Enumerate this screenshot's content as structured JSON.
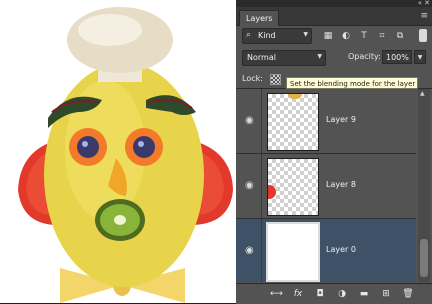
{
  "panel": {
    "window_controls": {
      "collapse": "«",
      "close": "✕"
    },
    "tab_label": "Layers",
    "menu_icon": "≡"
  },
  "filter": {
    "kind_icon": "⌕",
    "kind_label": "Kind",
    "dropdown": "▼",
    "icons": [
      "▦",
      "◐",
      "T",
      "⌗",
      "⧉"
    ]
  },
  "blend": {
    "mode": "Normal",
    "opacity_label": "Opacity:",
    "opacity_value": "100%"
  },
  "lock": {
    "label": "Lock:",
    "tooltip": "Set the blending mode for the layer"
  },
  "layers": [
    {
      "name": "Layer 9",
      "visible": true,
      "selected": false
    },
    {
      "name": "Layer 8",
      "visible": true,
      "selected": false
    },
    {
      "name": "Layer 0",
      "visible": true,
      "selected": true
    }
  ],
  "bottom_icons": [
    "⟷",
    "fx",
    "◘",
    "◑",
    "▬",
    "⊞",
    "🗑"
  ],
  "colors": {
    "panel_bg": "#535353",
    "selected_layer": "#3e5166",
    "tooltip_bg": "#fffbd5"
  }
}
